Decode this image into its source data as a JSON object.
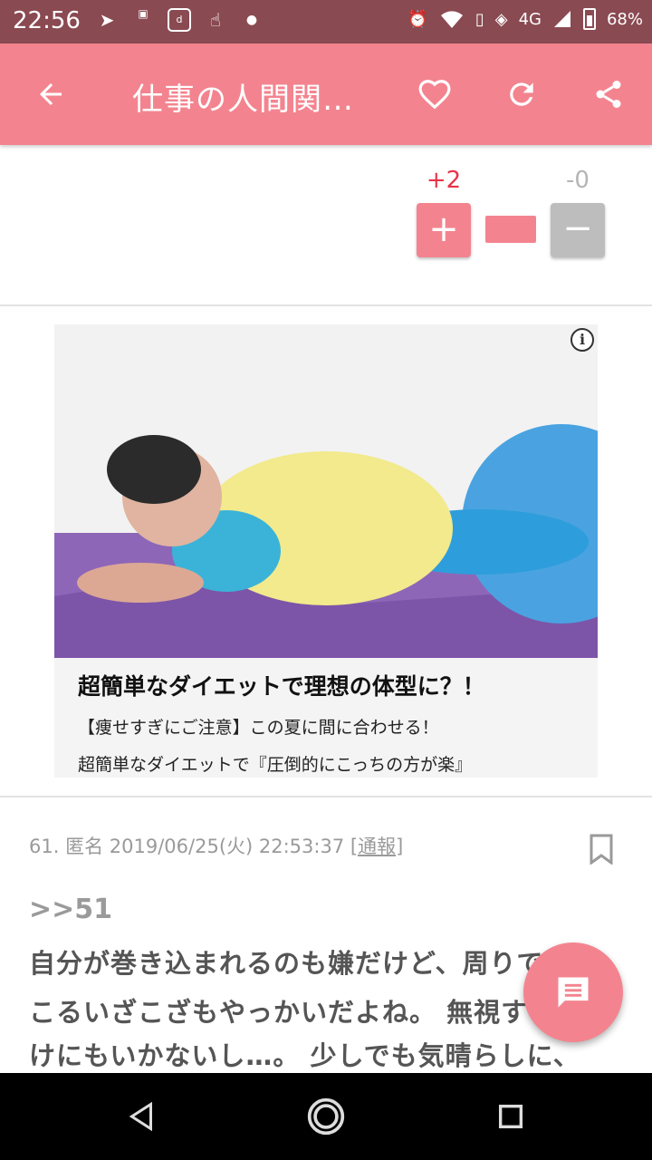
{
  "status_bar": {
    "time": "22:56",
    "left_icons": [
      "notification-icon",
      "manga-park-app-icon",
      "d-app-icon",
      "hand-app-icon",
      "dot-icon"
    ],
    "right_icons": [
      "alarm-icon",
      "wifi-icon",
      "no-sim-icon",
      "vibrate-icon"
    ],
    "network": "4G",
    "battery": "68%"
  },
  "app_bar": {
    "title": "仕事の人間関…",
    "icons": [
      "back-arrow-icon",
      "heart-icon",
      "refresh-icon",
      "share-icon"
    ],
    "color": "#f3848f"
  },
  "vote": {
    "plus_count": "+2",
    "minus_count": "-0",
    "plus_label": "+",
    "minus_label": "−",
    "ratio_plus": 1.0
  },
  "ad": {
    "info_label": "i",
    "headline": "超簡単なダイエットで理想の体型に？！",
    "line1": "【痩せすぎにご注意】この夏に間に合わせる！",
    "line2": "超簡単なダイエットで『圧倒的にこっちの方が楽』"
  },
  "comment": {
    "number": "61.",
    "author": "匿名",
    "datetime": "2019/06/25(火) 22:53:37",
    "report_label": "[通報]",
    "anchor": ">>51",
    "lines": [
      "自分が巻き込まれるのも嫌だけど、周りで起",
      "こるいざこざもやっかいだよね。 無視するわ",
      "けにもいかないし…。 少しでも気晴らしに、"
    ]
  },
  "colors": {
    "accent": "#f3848f",
    "status_bar": "#8a4a52",
    "plus_count": "#e8334a"
  }
}
